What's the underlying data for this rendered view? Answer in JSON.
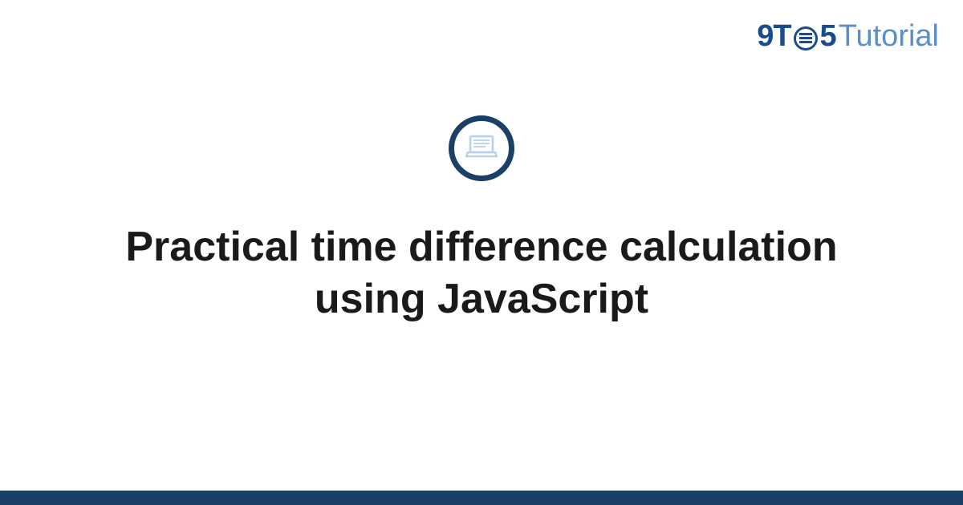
{
  "logo": {
    "part1": "9T",
    "part2": "5",
    "part3": "Tutorial"
  },
  "title": "Practical time difference calculation using JavaScript",
  "icon_name": "laptop-icon",
  "colors": {
    "primary_dark": "#1a4066",
    "primary": "#1a4d8f",
    "primary_light": "#5a8fc7",
    "icon_light": "#b8d0e8"
  }
}
